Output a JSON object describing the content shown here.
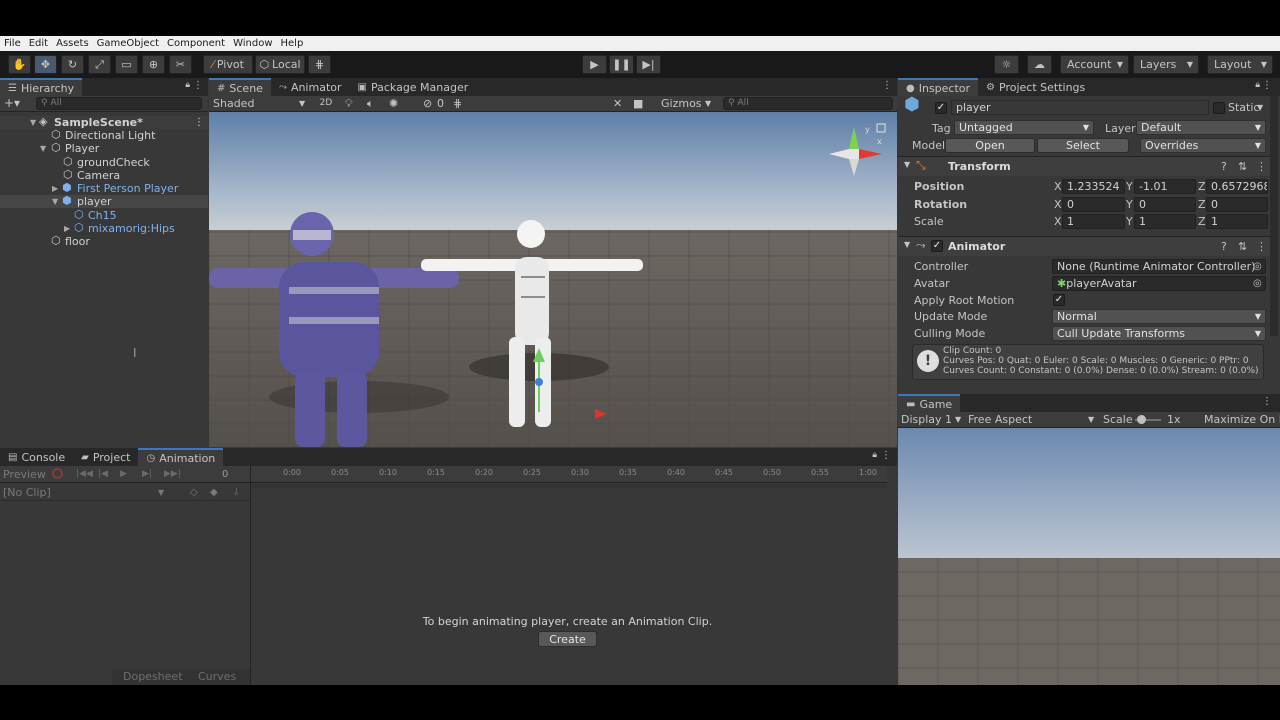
{
  "menu": [
    "File",
    "Edit",
    "Assets",
    "GameObject",
    "Component",
    "Window",
    "Help"
  ],
  "toolbar": {
    "pivot_label": "Pivot",
    "local_label": "Local",
    "account_label": "Account",
    "layers_label": "Layers",
    "layout_label": "Layout"
  },
  "hierarchy": {
    "tab": "Hierarchy",
    "search_placeholder": "All",
    "items": [
      {
        "label": "SampleScene*"
      },
      {
        "label": "Directional Light"
      },
      {
        "label": "Player"
      },
      {
        "label": "groundCheck"
      },
      {
        "label": "Camera"
      },
      {
        "label": "First Person Player"
      },
      {
        "label": "player"
      },
      {
        "label": "Ch15"
      },
      {
        "label": "mixamorig:Hips"
      },
      {
        "label": "floor"
      }
    ]
  },
  "scene": {
    "tabs": [
      "Scene",
      "Animator",
      "Package Manager"
    ],
    "shading": "Shaded",
    "mode_2d": "2D",
    "hidden_count": "0",
    "gizmos": "Gizmos",
    "search_placeholder": "All"
  },
  "inspector": {
    "tabs": [
      "Inspector",
      "Project Settings"
    ],
    "object_name": "player",
    "static_label": "Static",
    "tag_label": "Tag",
    "tag_value": "Untagged",
    "layer_label": "Layer",
    "layer_value": "Default",
    "model_label": "Model",
    "open_label": "Open",
    "select_label": "Select",
    "overrides_label": "Overrides",
    "transform": {
      "title": "Transform",
      "position_label": "Position",
      "rotation_label": "Rotation",
      "scale_label": "Scale",
      "axis_x": "X",
      "axis_y": "Y",
      "axis_z": "Z",
      "pos_x": "1.233524",
      "pos_y": "-1.01",
      "pos_z": "0.6572968",
      "rot_x": "0",
      "rot_y": "0",
      "rot_z": "0",
      "scale_x": "1",
      "scale_y": "1",
      "scale_z": "1"
    },
    "animator": {
      "title": "Animator",
      "controller_label": "Controller",
      "controller_value": "None (Runtime Animator Controller)",
      "avatar_label": "Avatar",
      "avatar_value": "playerAvatar",
      "root_motion_label": "Apply Root Motion",
      "update_mode_label": "Update Mode",
      "update_mode_value": "Normal",
      "culling_mode_label": "Culling Mode",
      "culling_mode_value": "Cull Update Transforms",
      "info_line1": "Clip Count: 0",
      "info_line2": "Curves Pos: 0 Quat: 0 Euler: 0 Scale: 0 Muscles: 0 Generic: 0 PPtr: 0",
      "info_line3": "Curves Count: 0 Constant: 0 (0.0%) Dense: 0 (0.0%) Stream: 0 (0.0%)"
    }
  },
  "bottom": {
    "tabs": [
      "Console",
      "Project",
      "Animation"
    ],
    "preview_label": "Preview",
    "clip_value": "[No Clip]",
    "frame_value": "0",
    "timeline_ticks": [
      "0:00",
      "0:05",
      "0:10",
      "0:15",
      "0:20",
      "0:25",
      "0:30",
      "0:35",
      "0:40",
      "0:45",
      "0:50",
      "0:55",
      "1:00"
    ],
    "message": "To begin animating player, create an Animation Clip.",
    "create_label": "Create",
    "dopesheet_label": "Dopesheet",
    "curves_label": "Curves"
  },
  "game": {
    "tab": "Game",
    "display": "Display 1",
    "aspect": "Free Aspect",
    "scale_label": "Scale",
    "scale_value": "1x",
    "maximize_label": "Maximize On Pl"
  }
}
